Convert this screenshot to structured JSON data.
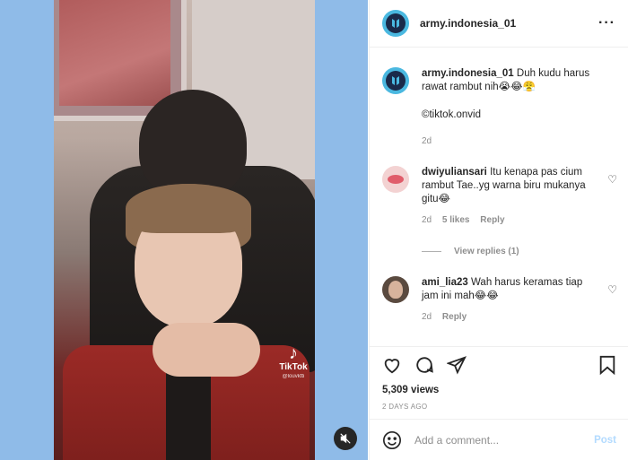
{
  "post": {
    "username": "army.indonesia_01",
    "more_icon": "more-horizontal-icon"
  },
  "video": {
    "watermark_brand": "TikTok",
    "watermark_handle": "@louvktti",
    "mute_icon": "speaker-muted-icon"
  },
  "caption": {
    "username": "army.indonesia_01",
    "text": "Duh kudu harus rawat rambut nih😭😂😤",
    "credit": "©tiktok.onvid",
    "time": "2d"
  },
  "comments": [
    {
      "username": "dwiyuliansari",
      "text": "Itu kenapa pas cium rambut Tae..yg warna biru mukanya gitu😂",
      "time": "2d",
      "likes": "5 likes",
      "reply_label": "Reply",
      "view_replies": "View replies (1)"
    },
    {
      "username": "ami_lia23",
      "text": "Wah harus keramas tiap jam ini mah😂😂",
      "time": "2d",
      "reply_label": "Reply"
    }
  ],
  "stats": {
    "views": "5,309 views",
    "posted": "2 DAYS AGO"
  },
  "add_comment": {
    "placeholder": "Add a comment...",
    "post_label": "Post"
  },
  "colors": {
    "background": "#8fbbe8",
    "link_disabled": "#b3dbff",
    "muted_text": "#8e8e8e"
  }
}
